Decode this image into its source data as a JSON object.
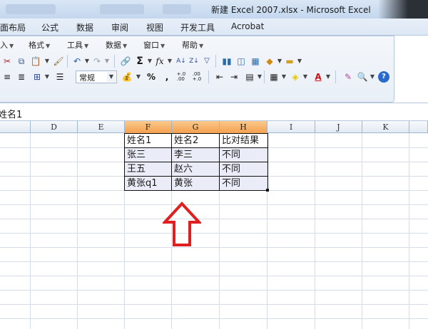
{
  "window": {
    "title": "新建 Excel 2007.xlsx - Microsoft Excel"
  },
  "ribbon_tabs": [
    "面布局",
    "公式",
    "数据",
    "审阅",
    "视图",
    "开发工具",
    "Acrobat"
  ],
  "menu_row": {
    "items": [
      "入",
      "格式",
      "工具",
      "数据",
      "窗口",
      "帮助"
    ]
  },
  "format_row": {
    "number_format": "常规",
    "percent": "%",
    "comma": ",",
    "inc_decimal": "+.0\n.00",
    "dec_decimal": ".00\n+.0"
  },
  "formula_bar": {
    "name_box": "姓名1"
  },
  "columns": [
    "D",
    "E",
    "F",
    "G",
    "H",
    "I",
    "J",
    "K"
  ],
  "selected_columns": [
    "F",
    "G",
    "H"
  ],
  "table": {
    "header": [
      "姓名1",
      "姓名2",
      "比对结果"
    ],
    "rows": [
      [
        "张三",
        "李三",
        "不同"
      ],
      [
        "王五",
        "赵六",
        "不同"
      ],
      [
        "黄张q1",
        "黄张",
        "不同"
      ]
    ]
  },
  "annotation": {
    "icon": "up-arrow-icon",
    "color": "#e02020"
  }
}
